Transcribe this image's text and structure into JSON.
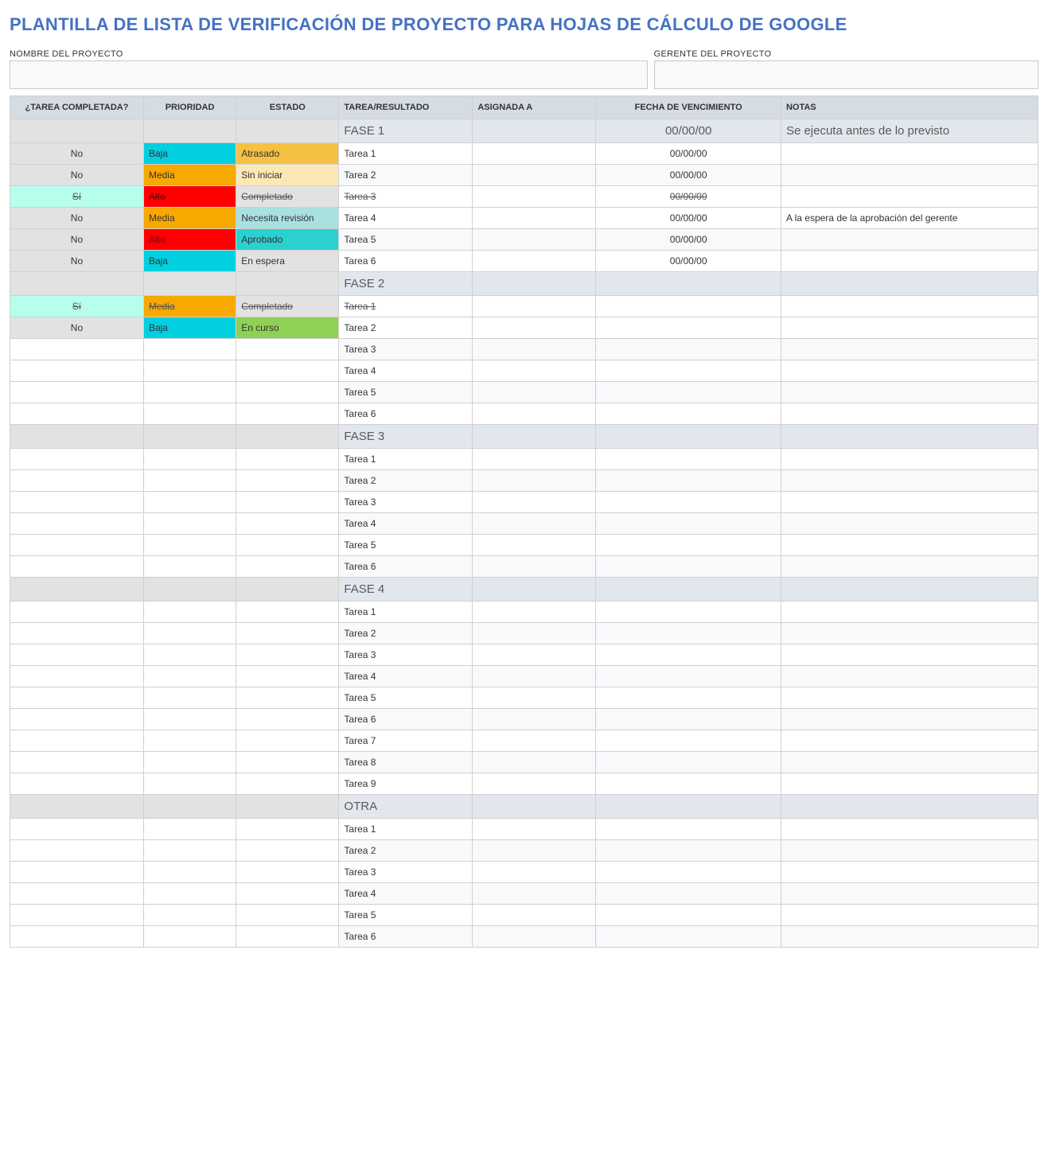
{
  "title": "PLANTILLA DE LISTA DE VERIFICACIÓN DE PROYECTO PARA HOJAS DE CÁLCULO DE GOOGLE",
  "meta": {
    "project_name_label": "NOMBRE DEL PROYECTO",
    "project_name_value": "",
    "manager_label": "GERENTE DEL PROYECTO",
    "manager_value": ""
  },
  "headers": {
    "done": "¿TAREA COMPLETADA?",
    "priority": "PRIORIDAD",
    "status": "ESTADO",
    "task": "TAREA/RESULTADO",
    "assigned": "ASIGNADA A",
    "due": "FECHA DE VENCIMIENTO",
    "notes": "NOTAS"
  },
  "colors": {
    "accent": "#4472C4",
    "header_bg": "#D6DCE4"
  },
  "rows": [
    {
      "type": "phase",
      "task": "FASE 1",
      "due": "00/00/00",
      "notes": "Se ejecuta antes de lo previsto"
    },
    {
      "type": "task",
      "done": "No",
      "priority": "Baja",
      "priority_cls": "pri-baja",
      "status": "Atrasado",
      "status_cls": "st-atrasado",
      "task": "Tarea 1",
      "assigned": "",
      "due": "00/00/00",
      "notes": ""
    },
    {
      "type": "task",
      "done": "No",
      "priority": "Media",
      "priority_cls": "pri-media",
      "status": "Sin iniciar",
      "status_cls": "st-siniciar",
      "task": "Tarea 2",
      "assigned": "",
      "due": "00/00/00",
      "notes": "",
      "stripe": true
    },
    {
      "type": "task",
      "done": "Sí",
      "done_cls": "done-si",
      "priority": "Alto",
      "priority_cls": "pri-alto",
      "status": "Completado",
      "status_cls": "st-completado",
      "task": "Tarea 3",
      "assigned": "",
      "due": "00/00/00",
      "notes": "",
      "strike": true
    },
    {
      "type": "task",
      "done": "No",
      "priority": "Media",
      "priority_cls": "pri-media",
      "status": "Necesita revisión",
      "status_cls": "st-revision",
      "task": "Tarea 4",
      "assigned": "",
      "due": "00/00/00",
      "notes": "A la espera de la aprobación del gerente"
    },
    {
      "type": "task",
      "done": "No",
      "priority": "Alto",
      "priority_cls": "pri-alto",
      "status": "Aprobado",
      "status_cls": "st-aprobado",
      "task": "Tarea 5",
      "assigned": "",
      "due": "00/00/00",
      "notes": "",
      "stripe": true
    },
    {
      "type": "task",
      "done": "No",
      "priority": "Baja",
      "priority_cls": "pri-baja",
      "status": "En espera",
      "status_cls": "st-espera",
      "task": "Tarea 6",
      "assigned": "",
      "due": "00/00/00",
      "notes": ""
    },
    {
      "type": "phase",
      "task": "FASE 2"
    },
    {
      "type": "task",
      "done": "Sí",
      "done_cls": "done-si",
      "priority": "Media",
      "priority_cls": "pri-media",
      "status": "Completado",
      "status_cls": "st-completado",
      "task": "Tarea 1",
      "assigned": "",
      "due": "",
      "notes": "",
      "strike": true
    },
    {
      "type": "task",
      "done": "No",
      "priority": "Baja",
      "priority_cls": "pri-baja",
      "status": "En curso",
      "status_cls": "st-encurso",
      "task": "Tarea 2",
      "assigned": "",
      "due": "",
      "notes": ""
    },
    {
      "type": "task",
      "done": "",
      "priority": "",
      "status": "",
      "task": "Tarea 3",
      "assigned": "",
      "due": "",
      "notes": "",
      "stripe": true
    },
    {
      "type": "task",
      "done": "",
      "priority": "",
      "status": "",
      "task": "Tarea 4",
      "assigned": "",
      "due": "",
      "notes": ""
    },
    {
      "type": "task",
      "done": "",
      "priority": "",
      "status": "",
      "task": "Tarea 5",
      "assigned": "",
      "due": "",
      "notes": "",
      "stripe": true
    },
    {
      "type": "task",
      "done": "",
      "priority": "",
      "status": "",
      "task": "Tarea 6",
      "assigned": "",
      "due": "",
      "notes": ""
    },
    {
      "type": "phase",
      "task": "FASE 3"
    },
    {
      "type": "task",
      "done": "",
      "priority": "",
      "status": "",
      "task": "Tarea 1",
      "assigned": "",
      "due": "",
      "notes": ""
    },
    {
      "type": "task",
      "done": "",
      "priority": "",
      "status": "",
      "task": "Tarea 2",
      "assigned": "",
      "due": "",
      "notes": "",
      "stripe": true
    },
    {
      "type": "task",
      "done": "",
      "priority": "",
      "status": "",
      "task": "Tarea 3",
      "assigned": "",
      "due": "",
      "notes": ""
    },
    {
      "type": "task",
      "done": "",
      "priority": "",
      "status": "",
      "task": "Tarea 4",
      "assigned": "",
      "due": "",
      "notes": "",
      "stripe": true
    },
    {
      "type": "task",
      "done": "",
      "priority": "",
      "status": "",
      "task": "Tarea 5",
      "assigned": "",
      "due": "",
      "notes": ""
    },
    {
      "type": "task",
      "done": "",
      "priority": "",
      "status": "",
      "task": "Tarea 6",
      "assigned": "",
      "due": "",
      "notes": "",
      "stripe": true
    },
    {
      "type": "phase",
      "task": "FASE 4"
    },
    {
      "type": "task",
      "done": "",
      "priority": "",
      "status": "",
      "task": "Tarea 1",
      "assigned": "",
      "due": "",
      "notes": ""
    },
    {
      "type": "task",
      "done": "",
      "priority": "",
      "status": "",
      "task": "Tarea 2",
      "assigned": "",
      "due": "",
      "notes": "",
      "stripe": true
    },
    {
      "type": "task",
      "done": "",
      "priority": "",
      "status": "",
      "task": "Tarea 3",
      "assigned": "",
      "due": "",
      "notes": ""
    },
    {
      "type": "task",
      "done": "",
      "priority": "",
      "status": "",
      "task": "Tarea 4",
      "assigned": "",
      "due": "",
      "notes": "",
      "stripe": true
    },
    {
      "type": "task",
      "done": "",
      "priority": "",
      "status": "",
      "task": "Tarea 5",
      "assigned": "",
      "due": "",
      "notes": ""
    },
    {
      "type": "task",
      "done": "",
      "priority": "",
      "status": "",
      "task": "Tarea 6",
      "assigned": "",
      "due": "",
      "notes": "",
      "stripe": true
    },
    {
      "type": "task",
      "done": "",
      "priority": "",
      "status": "",
      "task": "Tarea 7",
      "assigned": "",
      "due": "",
      "notes": ""
    },
    {
      "type": "task",
      "done": "",
      "priority": "",
      "status": "",
      "task": "Tarea 8",
      "assigned": "",
      "due": "",
      "notes": "",
      "stripe": true
    },
    {
      "type": "task",
      "done": "",
      "priority": "",
      "status": "",
      "task": "Tarea 9",
      "assigned": "",
      "due": "",
      "notes": ""
    },
    {
      "type": "phase",
      "task": "OTRA"
    },
    {
      "type": "task",
      "done": "",
      "priority": "",
      "status": "",
      "task": "Tarea 1",
      "assigned": "",
      "due": "",
      "notes": ""
    },
    {
      "type": "task",
      "done": "",
      "priority": "",
      "status": "",
      "task": "Tarea 2",
      "assigned": "",
      "due": "",
      "notes": "",
      "stripe": true
    },
    {
      "type": "task",
      "done": "",
      "priority": "",
      "status": "",
      "task": "Tarea 3",
      "assigned": "",
      "due": "",
      "notes": ""
    },
    {
      "type": "task",
      "done": "",
      "priority": "",
      "status": "",
      "task": "Tarea 4",
      "assigned": "",
      "due": "",
      "notes": "",
      "stripe": true
    },
    {
      "type": "task",
      "done": "",
      "priority": "",
      "status": "",
      "task": "Tarea 5",
      "assigned": "",
      "due": "",
      "notes": ""
    },
    {
      "type": "task",
      "done": "",
      "priority": "",
      "status": "",
      "task": "Tarea 6",
      "assigned": "",
      "due": "",
      "notes": "",
      "stripe": true
    }
  ]
}
